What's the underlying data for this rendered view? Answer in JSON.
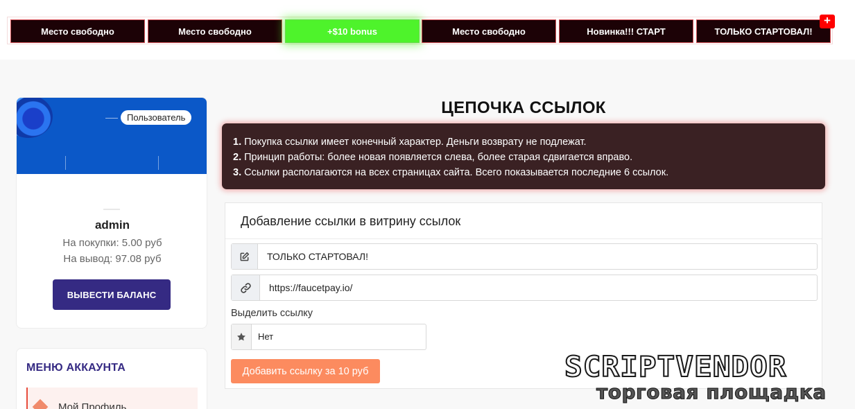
{
  "link_chain": {
    "items": [
      {
        "label": "Место свободно",
        "style": "dark"
      },
      {
        "label": "Место свободно",
        "style": "dark"
      },
      {
        "label": "+$10 bonus",
        "style": "bonus"
      },
      {
        "label": "Место свободно",
        "style": "dark"
      },
      {
        "label": "Новинка!!! СТАРТ",
        "style": "dark"
      },
      {
        "label": "ТОЛЬКО СТАРТОВАЛ!",
        "style": "dark"
      }
    ],
    "add_badge": "+"
  },
  "profile": {
    "role": "Пользователь",
    "username": "admin",
    "purchase_balance": "На покупки: 5.00 руб",
    "withdraw_balance": "На вывод: 97.08 руб",
    "withdraw_button": "ВЫВЕСТИ БАЛАНС"
  },
  "account_menu": {
    "title": "МЕНЮ АККАУНТА",
    "items": [
      {
        "label": "Мой Профиль"
      }
    ]
  },
  "main": {
    "title": "ЦЕПОЧКА ССЫЛОК",
    "rules": [
      {
        "num": "1.",
        "text": " Покупка ссылки имеет конечный характер. Деньги возврату не подлежат."
      },
      {
        "num": "2.",
        "text": " Принцип работы: более новая появляется слева, более старая сдвигается вправо."
      },
      {
        "num": "3.",
        "text": " Ссылки располагаются на всех страницах сайта. Всего показывается последние 6 ссылок."
      }
    ],
    "form": {
      "title": "Добавление ссылки в витрину ссылок",
      "link_text_value": "ТОЛЬКО СТАРТОВАЛ!",
      "link_url_value": "https://faucetpay.io/",
      "highlight_label": "Выделить ссылку",
      "highlight_value": "Нет",
      "submit_label": "Добавить ссылку за 10 руб"
    }
  },
  "watermark": {
    "line1": "SCRIPTVENDOR",
    "line2": "торговая площадка"
  },
  "colors": {
    "chain_button_bg": "#1c0206",
    "chain_button_border": "#d9545a",
    "bonus_green": "#4ef32b",
    "banner_blue": "#0b58c8",
    "primary_purple": "#352a83",
    "rules_bg": "#3a2123",
    "submit_orange": "#fc8b5f",
    "badge_red": "#ff0000"
  },
  "icons": {
    "text_field": "edit-icon",
    "url_field": "link-icon",
    "highlight": "star-icon",
    "menu_profile": "diamond-icon"
  }
}
